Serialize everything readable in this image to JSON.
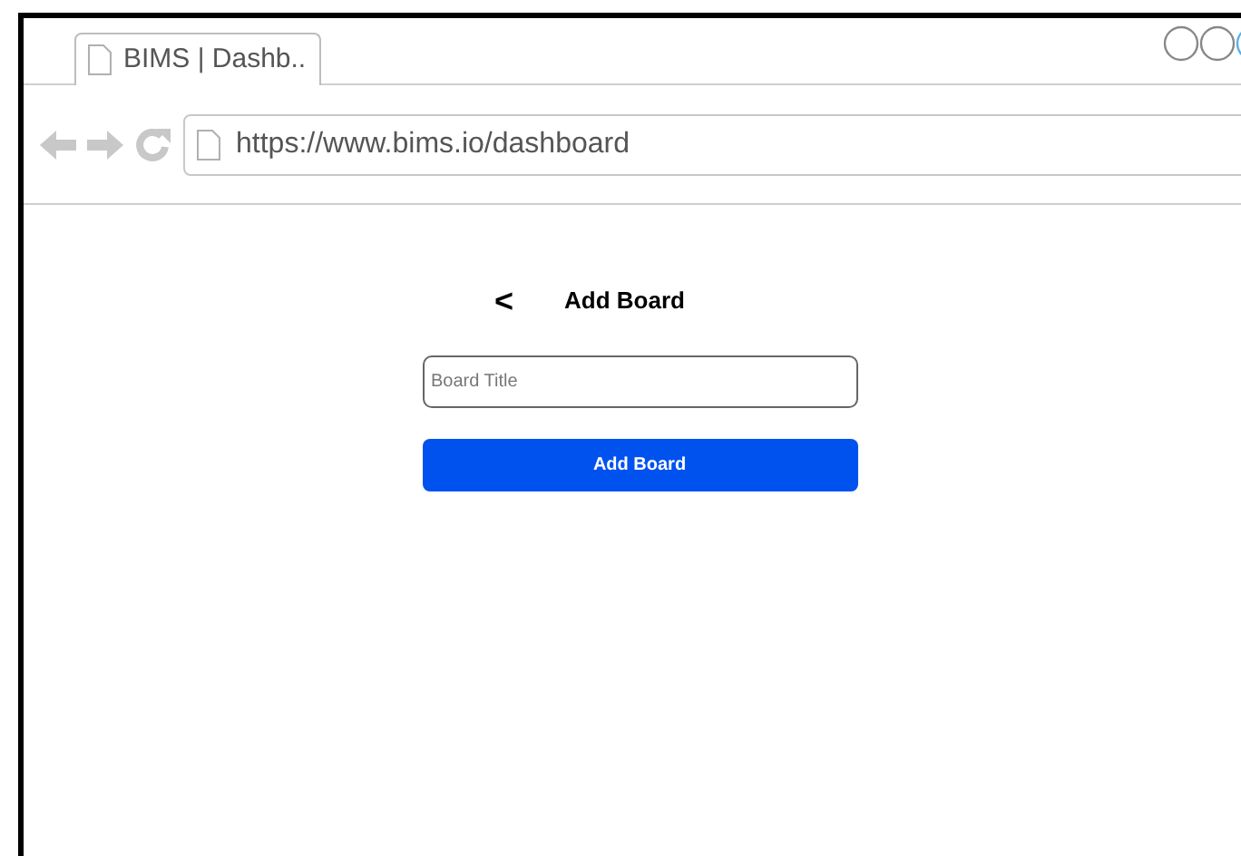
{
  "browser": {
    "tab_title": "BIMS | Dashb..",
    "url": "https://www.bims.io/dashboard"
  },
  "page": {
    "title": "Add Board",
    "back": "<",
    "field": {
      "placeholder": "Board Title"
    },
    "button": "Add Board"
  }
}
